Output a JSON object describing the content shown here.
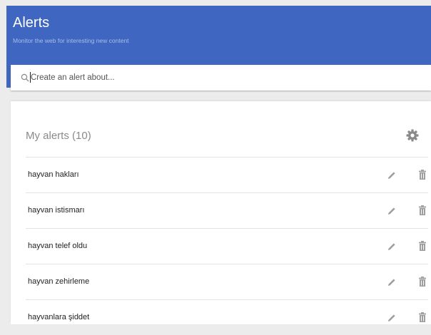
{
  "header": {
    "title": "Alerts",
    "subtitle": "Monitor the web for interesting new content",
    "color": "#3f67c2"
  },
  "search": {
    "placeholder": "Create an alert about...",
    "icon": "search-icon"
  },
  "alerts_panel": {
    "title": "My alerts (10)",
    "settings_icon": "gear-icon",
    "items": [
      {
        "label": "hayvan hakları"
      },
      {
        "label": "hayvan istismarı"
      },
      {
        "label": "hayvan telef oldu"
      },
      {
        "label": "hayvan zehirleme"
      },
      {
        "label": "hayvanlara şiddet"
      }
    ],
    "edit_icon": "pencil-icon",
    "delete_icon": "trash-icon"
  }
}
